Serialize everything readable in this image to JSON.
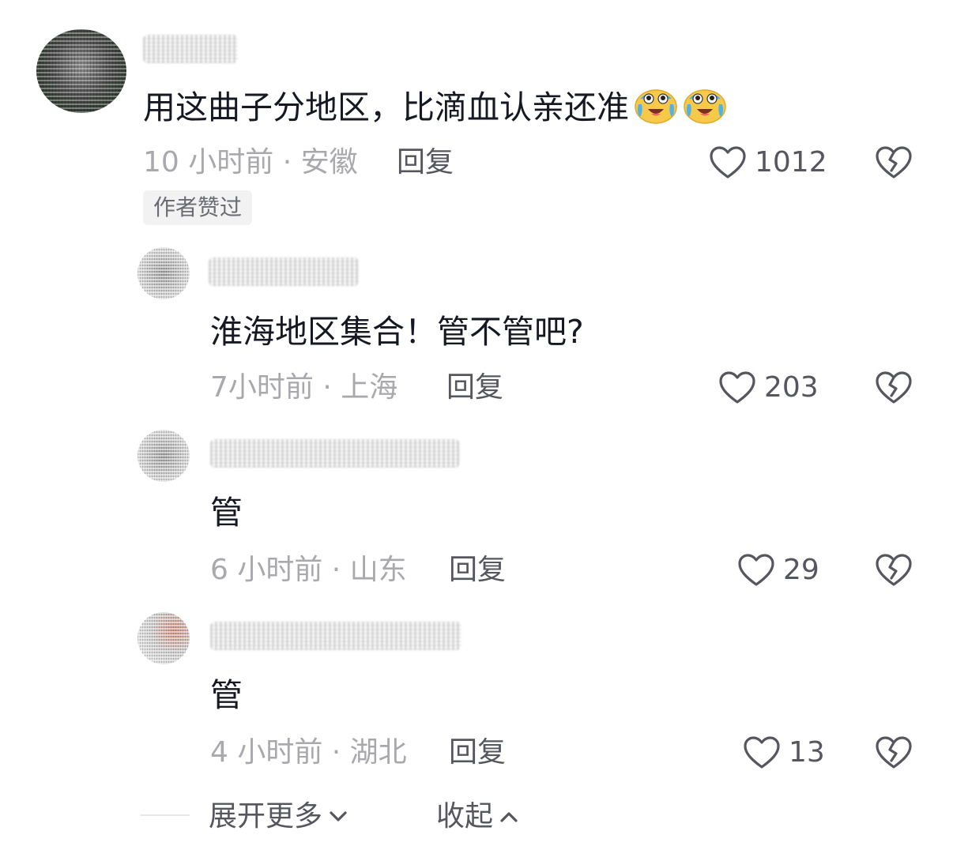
{
  "comments": [
    {
      "content": "用这曲子分地区，比滴血认亲还准",
      "time_location": "10 小时前 · 安徽",
      "reply_label": "回复",
      "likes": "1012",
      "badge": "作者赞过",
      "emojis": [
        "crying-laughing-emoji",
        "crying-laughing-emoji"
      ]
    },
    {
      "content": "淮海地区集合！管不管吧?",
      "time_location": "7小时前 · 上海",
      "reply_label": "回复",
      "likes": "203"
    },
    {
      "content": "管",
      "time_location": "6 小时前 · 山东",
      "reply_label": "回复",
      "likes": "29"
    },
    {
      "content": "管",
      "time_location": "4 小时前 · 湖北",
      "reply_label": "回复",
      "likes": "13"
    }
  ],
  "footer": {
    "expand_label": "展开更多",
    "collapse_label": "收起"
  },
  "colors": {
    "text": "#161823",
    "meta": "#a8a8ad",
    "action": "#56575e",
    "badge_bg": "#f2f2f3"
  },
  "icons": [
    "heart-outline-icon",
    "broken-heart-icon",
    "chevron-down-icon",
    "chevron-up-icon"
  ]
}
